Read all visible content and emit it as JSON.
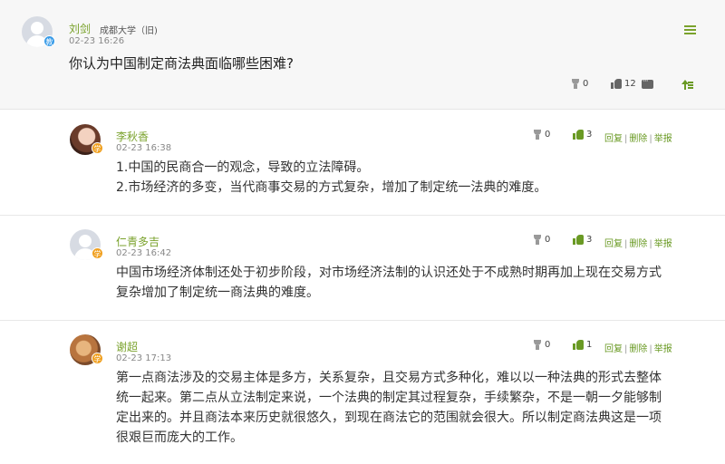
{
  "post": {
    "author": "刘剑",
    "school": "成都大学（旧)",
    "time": "02-23 16:26",
    "badge": "教",
    "question": "你认为中国制定商法典面临哪些困难?",
    "trophy_count": "0",
    "like_count": "12"
  },
  "replies": [
    {
      "author": "李秋香",
      "time": "02-23 16:38",
      "badge": "学",
      "trophy_count": "0",
      "like_count": "3",
      "lines": [
        "1.中国的民商合一的观念，导致的立法障碍。",
        "2.市场经济的多变，当代商事交易的方式复杂，增加了制定统一法典的难度。"
      ]
    },
    {
      "author": "仁青多吉",
      "time": "02-23 16:42",
      "badge": "学",
      "trophy_count": "0",
      "like_count": "3",
      "lines": [
        "中国市场经济体制还处于初步阶段，对市场经济法制的认识还处于不成熟时期再加上现在交易方式",
        "复杂增加了制定统一商法典的难度。"
      ]
    },
    {
      "author": "谢超",
      "time": "02-23 17:13",
      "badge": "学",
      "trophy_count": "0",
      "like_count": "1",
      "lines": [
        "第一点商法涉及的交易主体是多方，关系复杂，且交易方式多种化，难以以一种法典的形式去整体",
        "统一起来。第二点从立法制定来说，一个法典的制定其过程复杂，手续繁杂，不是一朝一夕能够制",
        "定出来的。并且商法本来历史就很悠久，到现在商法它的范围就会很大。所以制定商法典这是一项",
        "很艰巨而庞大的工作。"
      ]
    }
  ],
  "actions": {
    "reply": "回复",
    "delete": "删除",
    "report": "举报",
    "separator": "|"
  },
  "colors": {
    "accent_green": "#7aa22c",
    "like_green": "#6a9a24",
    "teacher_badge": "#3a9ce8",
    "student_badge": "#f0a020"
  },
  "icons": [
    "menu-icon",
    "trophy-icon",
    "thumbs-up-icon",
    "comment-icon",
    "top-arrow-icon"
  ]
}
